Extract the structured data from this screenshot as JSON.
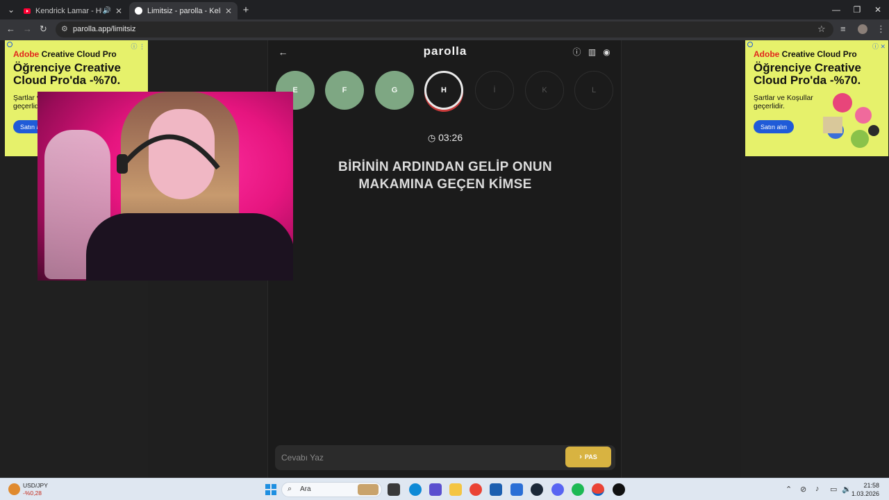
{
  "browser": {
    "tabs": [
      {
        "title": "Kendrick Lamar - HUMBLE.",
        "active": false
      },
      {
        "title": "Limitsiz - parolla - Kelime oyunu",
        "active": true
      }
    ],
    "new_tab": "+",
    "url": "parolla.app/limitsiz"
  },
  "app": {
    "title": "parolla",
    "letters": [
      {
        "label": "E",
        "state": "done"
      },
      {
        "label": "F",
        "state": "done"
      },
      {
        "label": "G",
        "state": "done"
      },
      {
        "label": "H",
        "state": "current"
      },
      {
        "label": "İ",
        "state": "pending"
      },
      {
        "label": "K",
        "state": "pending"
      },
      {
        "label": "L",
        "state": "pending"
      }
    ],
    "timer": "03:26",
    "question": "BİRİNİN ARDINDAN GELİP ONUN MAKAMINA GEÇEN KİMSE",
    "answer_placeholder": "Cevabı Yaz",
    "pass_label": "PAS"
  },
  "ads": {
    "left": {
      "brand_red": "Adobe",
      "brand_rest": " Creative Cloud Pro",
      "headline": "Öğrenciye Creative Cloud Pro'da -%70.",
      "terms": "Şartlar ve Koşullar geçerlidir.",
      "cta": "Satın alın"
    },
    "right": {
      "brand_red": "Adobe",
      "brand_rest": " Creative Cloud Pro",
      "headline": "Öğrenciye Creative Cloud Pro'da -%70.",
      "terms": "Şartlar ve Koşullar geçerlidir.",
      "cta": "Satın alın"
    }
  },
  "taskbar": {
    "ticker_name": "USD/JPY",
    "ticker_change": "-%0,28",
    "search_label": "Ara",
    "time": "21:58",
    "date": "1.03.2026"
  },
  "colors": {
    "done": "#7ea783",
    "current_ring": "#c83a3a",
    "pass_button": "#d8b341",
    "ad_background": "#e6f16b"
  }
}
